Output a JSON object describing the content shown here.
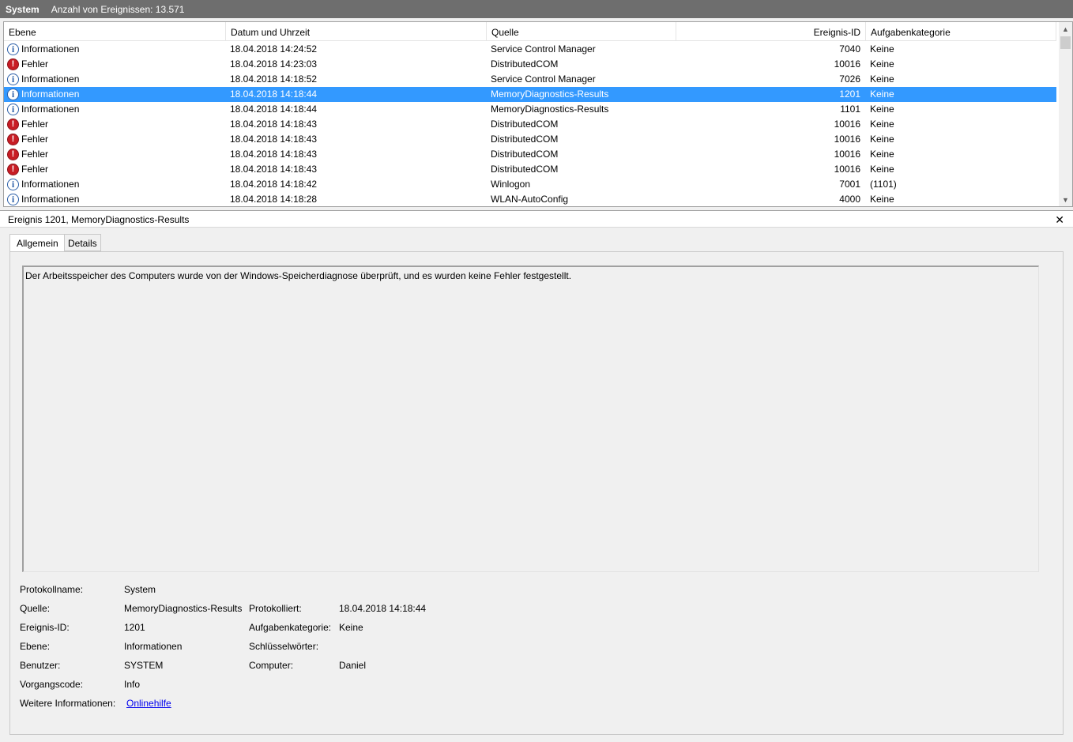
{
  "titlebar": {
    "log_name": "System",
    "event_count": "Anzahl von Ereignissen: 13.571"
  },
  "columns": {
    "level": "Ebene",
    "date": "Datum und Uhrzeit",
    "source": "Quelle",
    "id": "Ereignis-ID",
    "category": "Aufgabenkategorie"
  },
  "rows": [
    {
      "icon": "info-icon",
      "level": "Informationen",
      "date": "18.04.2018 14:24:52",
      "source": "Service Control Manager",
      "id": "7040",
      "category": "Keine",
      "selected": false
    },
    {
      "icon": "error-icon",
      "level": "Fehler",
      "date": "18.04.2018 14:23:03",
      "source": "DistributedCOM",
      "id": "10016",
      "category": "Keine",
      "selected": false
    },
    {
      "icon": "info-icon",
      "level": "Informationen",
      "date": "18.04.2018 14:18:52",
      "source": "Service Control Manager",
      "id": "7026",
      "category": "Keine",
      "selected": false
    },
    {
      "icon": "info-icon",
      "level": "Informationen",
      "date": "18.04.2018 14:18:44",
      "source": "MemoryDiagnostics-Results",
      "id": "1201",
      "category": "Keine",
      "selected": true
    },
    {
      "icon": "info-icon",
      "level": "Informationen",
      "date": "18.04.2018 14:18:44",
      "source": "MemoryDiagnostics-Results",
      "id": "1101",
      "category": "Keine",
      "selected": false
    },
    {
      "icon": "error-icon",
      "level": "Fehler",
      "date": "18.04.2018 14:18:43",
      "source": "DistributedCOM",
      "id": "10016",
      "category": "Keine",
      "selected": false
    },
    {
      "icon": "error-icon",
      "level": "Fehler",
      "date": "18.04.2018 14:18:43",
      "source": "DistributedCOM",
      "id": "10016",
      "category": "Keine",
      "selected": false
    },
    {
      "icon": "error-icon",
      "level": "Fehler",
      "date": "18.04.2018 14:18:43",
      "source": "DistributedCOM",
      "id": "10016",
      "category": "Keine",
      "selected": false
    },
    {
      "icon": "error-icon",
      "level": "Fehler",
      "date": "18.04.2018 14:18:43",
      "source": "DistributedCOM",
      "id": "10016",
      "category": "Keine",
      "selected": false
    },
    {
      "icon": "info-icon",
      "level": "Informationen",
      "date": "18.04.2018 14:18:42",
      "source": "Winlogon",
      "id": "7001",
      "category": "(1101)",
      "selected": false
    },
    {
      "icon": "info-icon",
      "level": "Informationen",
      "date": "18.04.2018 14:18:28",
      "source": "WLAN-AutoConfig",
      "id": "4000",
      "category": "Keine",
      "selected": false
    }
  ],
  "detail": {
    "title": "Ereignis 1201, MemoryDiagnostics-Results",
    "tabs": {
      "general": "Allgemein",
      "details": "Details"
    },
    "description": "Der Arbeitsspeicher des Computers wurde von der Windows-Speicherdiagnose überprüft, und es wurden keine Fehler festgestellt.",
    "labels": {
      "log_name": "Protokollname:",
      "source": "Quelle:",
      "event_id": "Ereignis-ID:",
      "level": "Ebene:",
      "user": "Benutzer:",
      "opcode": "Vorgangscode:",
      "more_info": "Weitere Informationen:",
      "logged": "Protokolliert:",
      "task_category": "Aufgabenkategorie:",
      "keywords": "Schlüsselwörter:",
      "computer": "Computer:"
    },
    "values": {
      "log_name": "System",
      "source": "MemoryDiagnostics-Results",
      "event_id": "1201",
      "level": "Informationen",
      "user": "SYSTEM",
      "opcode": "Info",
      "more_info_link": "Onlinehilfe",
      "logged": "18.04.2018 14:18:44",
      "task_category": "Keine",
      "keywords": "",
      "computer": "Daniel"
    }
  }
}
